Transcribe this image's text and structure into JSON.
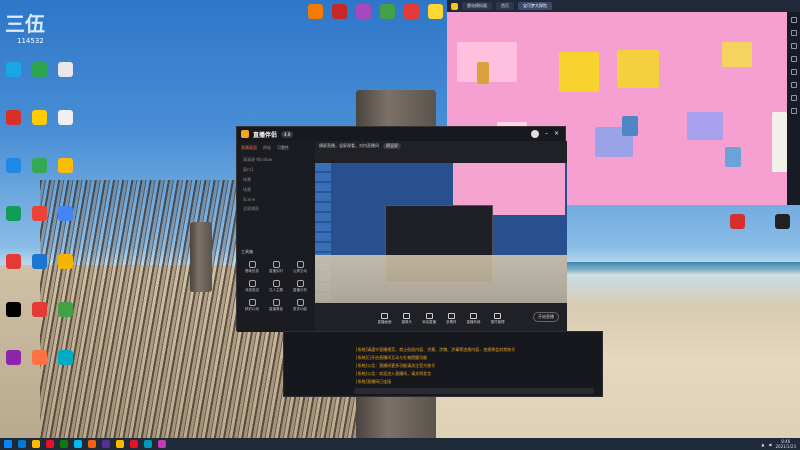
{
  "desktop": {
    "watermark": "三伍",
    "watermark_sub": "114532",
    "left_icons": [
      {
        "color": "#1aa5e6"
      },
      {
        "color": "#2da44e"
      },
      {
        "color": "#e8e8e8"
      },
      {
        "color": "#d93025"
      },
      {
        "color": "#ffcc00"
      },
      {
        "color": "#f0f0f0"
      },
      {
        "color": "#1e88e5"
      },
      {
        "color": "#34a853"
      },
      {
        "color": "#fbbc04"
      },
      {
        "color": "#0f9d58"
      },
      {
        "color": "#ea4335"
      },
      {
        "color": "#4285f4"
      },
      {
        "color": "#e53935"
      },
      {
        "color": "#1976d2"
      },
      {
        "color": "#f4b400"
      },
      {
        "color": "#000000"
      },
      {
        "color": "#e53935"
      },
      {
        "color": "#43a047"
      },
      {
        "color": "#8e24aa"
      },
      {
        "color": "#ff7043"
      },
      {
        "color": "#00acc1"
      }
    ],
    "top_icons": [
      {
        "color": "#f57c00"
      },
      {
        "color": "#c62828"
      },
      {
        "color": "#ab47bc"
      },
      {
        "color": "#43a047"
      },
      {
        "color": "#e53935"
      },
      {
        "color": "#fdd835"
      }
    ],
    "right_icons": [
      {
        "color": "#d32f2f"
      },
      {
        "color": "#212121"
      }
    ]
  },
  "emulator": {
    "tabs": [
      "雷电模拟器",
      "首页",
      "宝可梦大探险"
    ],
    "active_tab": 2
  },
  "stream_app": {
    "title": "直播伴侣",
    "badge": "4.0",
    "nav": [
      "直播画面",
      "评论",
      "可靠性"
    ],
    "scene_items": [
      "高清源 Window",
      "窗口1",
      "场景",
      "场景",
      "Scene",
      "全屏捕获"
    ],
    "tools_header": "工具箱",
    "tools": [
      "基础信息",
      "直播实时",
      "公屏互动",
      "消息推送",
      "达人主题",
      "直播分析",
      "精彩片段",
      "直播看板",
      "更多功能"
    ],
    "top_info": "横屏直播，竖屏观看，对内直播间",
    "top_badge": "横竖屏",
    "controls": [
      "直播画面",
      "摄像头",
      "添加直播",
      "多素材",
      "直播布局",
      "插件管理"
    ],
    "go_live": "开始直播"
  },
  "chat": {
    "lines": [
      "[系统]请遵守直播规范，禁止低俗内容、涉黄、涉赌、涉毒等违规内容，违规将会封禁账号",
      "[系统]已开启直播间互动与礼物提醒功能",
      "[系统]公告：直播间更多功能请关注官方账号",
      "[系统]公告：欢迎进入直播间，请文明发言",
      "[系统]直播间已连接"
    ]
  },
  "taskbar": {
    "time": "8:46",
    "date": "2021/1/23",
    "icon_colors": [
      "#0078d4",
      "#ffb900",
      "#e81123",
      "#107c10",
      "#00bcf2",
      "#f7630c",
      "#5c2d91",
      "#ffb900",
      "#e81123",
      "#0099bc",
      "#c239b3"
    ]
  }
}
